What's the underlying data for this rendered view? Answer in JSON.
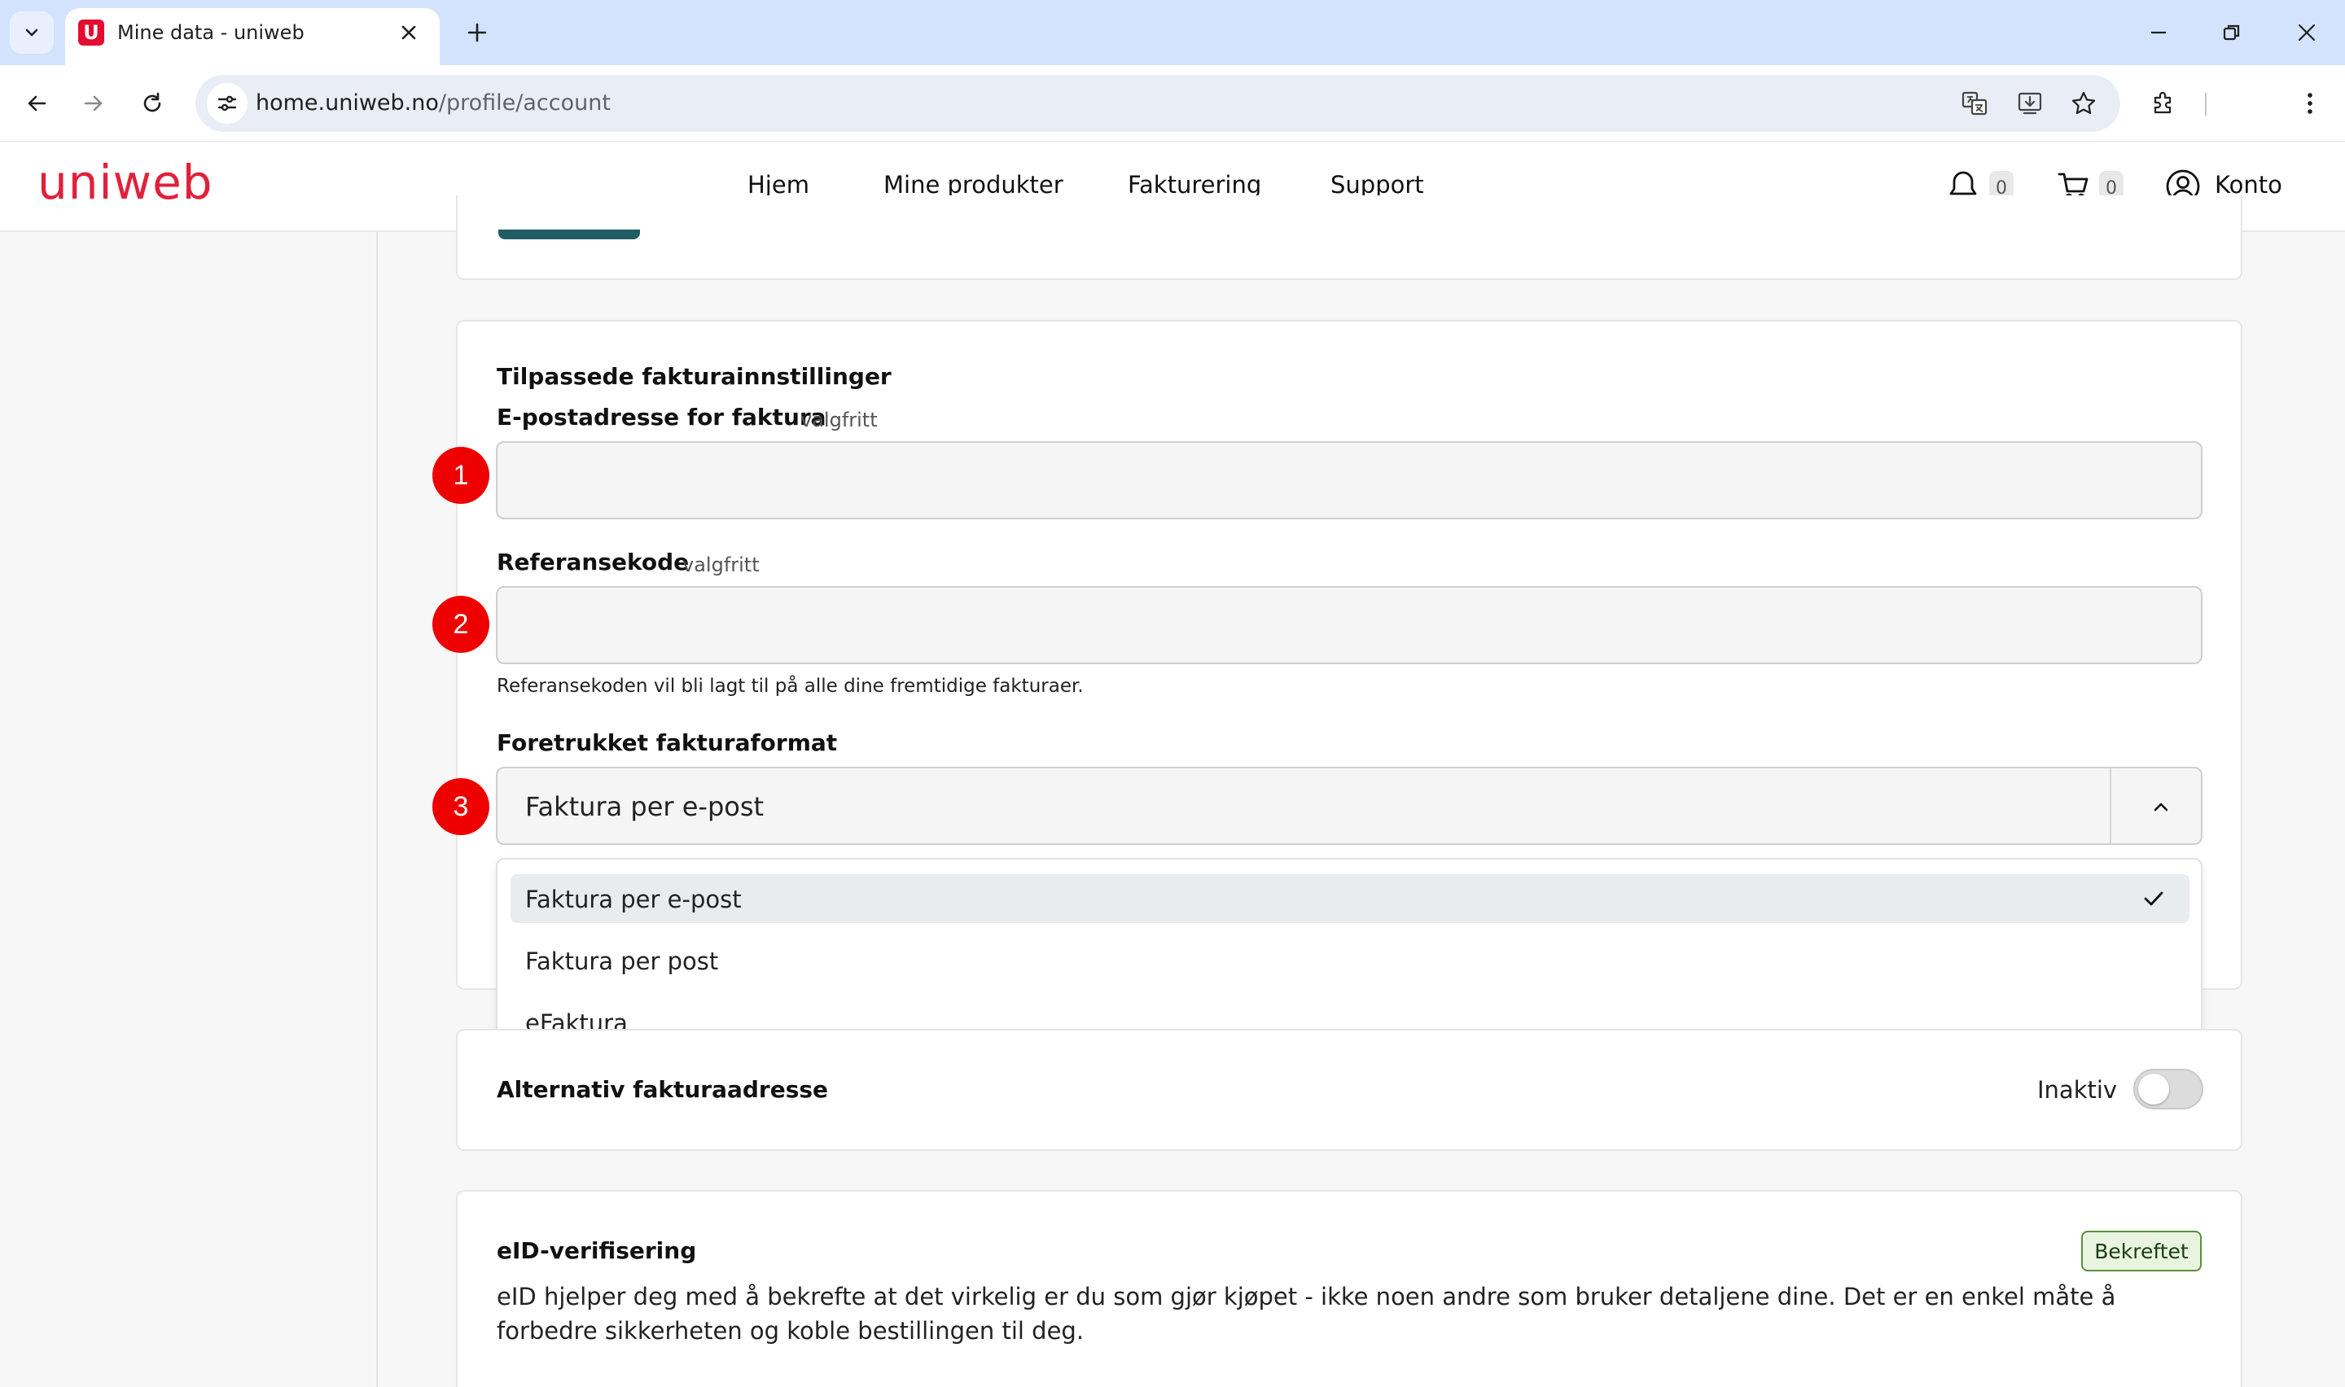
{
  "browser": {
    "tab_title": "Mine data - uniweb",
    "favicon_letter": "U",
    "url_host": "home.uniweb.no",
    "url_path": "/profile/account"
  },
  "site": {
    "logo": "uniweb",
    "brand_color": "#e1213c",
    "nav": [
      "Hjem",
      "Mine produkter",
      "Fakturering",
      "Support"
    ],
    "notifications_count": "0",
    "cart_count": "0",
    "account_label": "Konto"
  },
  "billing": {
    "section_title": "Tilpassede fakturainnstillinger",
    "email_label": "E-postadresse for faktura",
    "email_optional": "valgfritt",
    "email_value": "",
    "reference_label": "Referansekode",
    "reference_optional": "valgfritt",
    "reference_value": "",
    "reference_help": "Referansekoden vil bli lagt til på alle dine fremtidige fakturaer.",
    "format_label": "Foretrukket fakturaformat",
    "format_selected": "Faktura per e-post",
    "format_options": [
      "Faktura per e-post",
      "Faktura per post",
      "eFaktura"
    ]
  },
  "markers": [
    "1",
    "2",
    "3"
  ],
  "alt_address": {
    "label": "Alternativ fakturaadresse",
    "status": "Inaktiv",
    "enabled": false
  },
  "eid": {
    "title": "eID-verifisering",
    "badge": "Bekreftet",
    "description": "eID hjelper deg med å bekrefte at det virkelig er du som gjør kjøpet - ikke noen andre som bruker detaljene dine. Det er en enkel måte å forbedre sikkerheten og koble bestillingen til deg."
  }
}
